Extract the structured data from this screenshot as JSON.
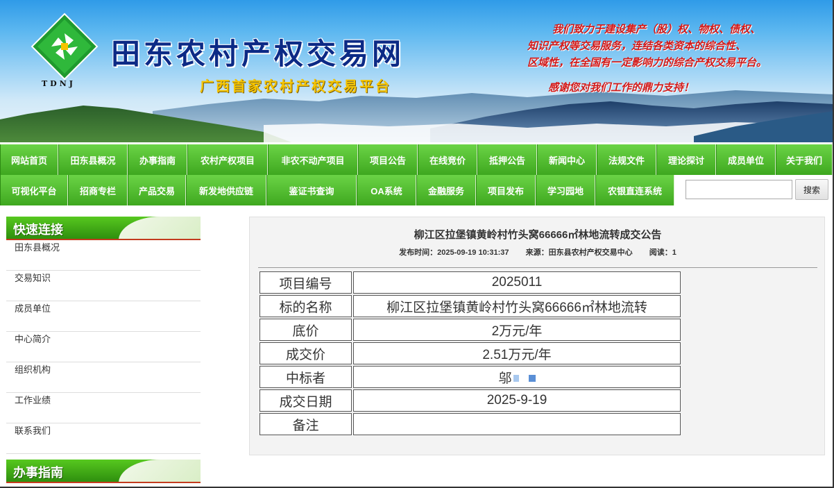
{
  "banner": {
    "logo_text": "TDNJ",
    "title": "田东农村产权交易网",
    "subtitle": "广西首家农村产权交易平台",
    "slogan_line1": "我们致力于建设集产（股）权、物权、债权、",
    "slogan_line2": "知识产权等交易服务，连结各类资本的综合性、",
    "slogan_line3": "区域性，在全国有一定影响力的综合产权交易平台。",
    "thanks": "感谢您对我们工作的鼎力支持！"
  },
  "nav": {
    "row1": [
      "网站首页",
      "田东县概况",
      "办事指南",
      "农村产权项目",
      "非农不动产项目",
      "项目公告",
      "在线竞价",
      "抵押公告",
      "新闻中心",
      "法规文件",
      "理论探讨",
      "成员单位",
      "关于我们"
    ],
    "row2": [
      "可视化平台",
      "招商专栏",
      "产品交易",
      "新发地供应链",
      "鉴证书查询",
      "OA系统",
      "金融服务",
      "项目发布",
      "学习园地",
      "农银直连系统"
    ],
    "search_placeholder": "",
    "search_button": "搜索"
  },
  "sidebar": {
    "quick_title": "快速连接",
    "items": [
      "田东县概况",
      "交易知识",
      "成员单位",
      "中心简介",
      "组织机构",
      "工作业绩",
      "联系我们"
    ],
    "guide_title": "办事指南"
  },
  "article": {
    "title": "柳江区拉堡镇黄岭村竹头窝66666㎡林地流转成交公告",
    "publish_label": "发布时间：",
    "publish_time": "2025-09-19 10:31:37",
    "source_label": "来源：",
    "source": "田东县农村产权交易中心",
    "read_label": "阅读：",
    "reads": "1",
    "rows": [
      {
        "k": "项目编号",
        "v": "2025011"
      },
      {
        "k": "标的名称",
        "v": "柳江区拉堡镇黄岭村竹头窝66666㎡林地流转"
      },
      {
        "k": "底价",
        "v": "2万元/年"
      },
      {
        "k": "成交价",
        "v": "2.51万元/年"
      },
      {
        "k": "中标者",
        "v": "邬"
      },
      {
        "k": "成交日期",
        "v": "2025-9-19"
      },
      {
        "k": "备注",
        "v": ""
      }
    ]
  },
  "colors": {
    "nav_green": "#3ea81f",
    "title_blue": "#0c2a86",
    "slogan_red": "#d11a1a",
    "subtitle_gold": "#f5c400"
  }
}
